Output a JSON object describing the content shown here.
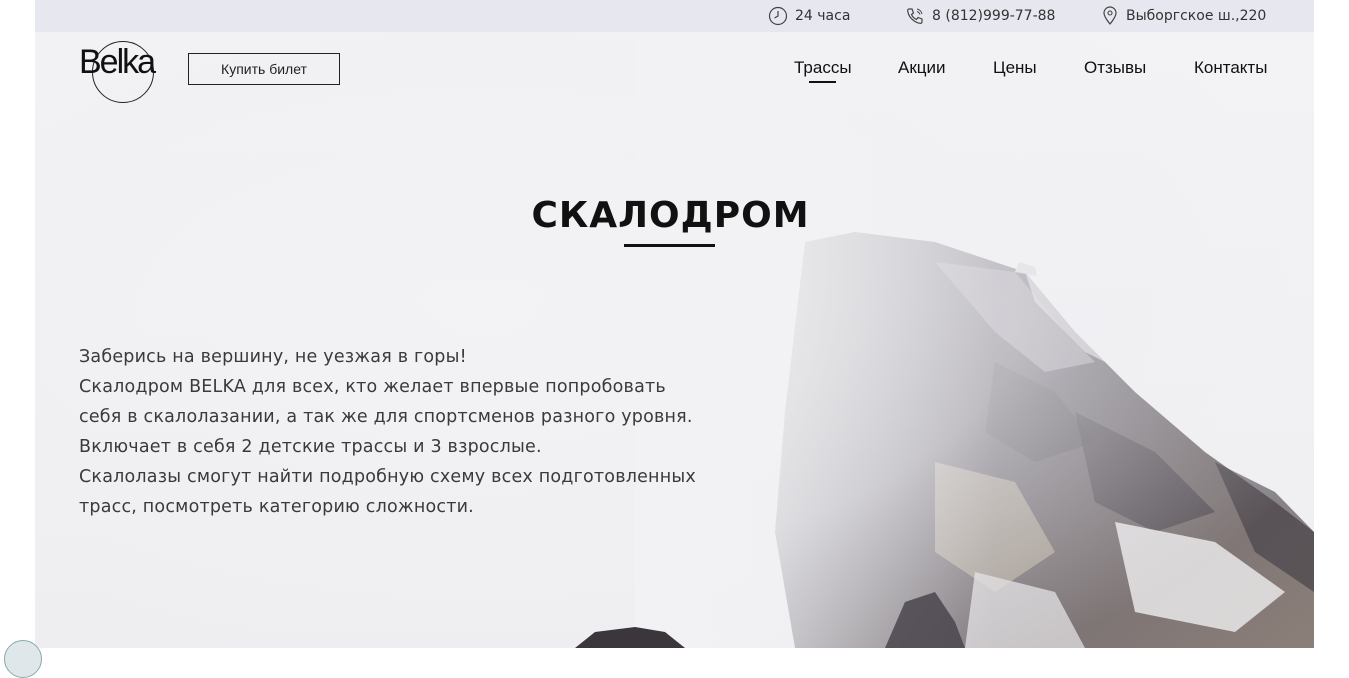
{
  "topbar": {
    "hours": "24 часа",
    "phone": "8 (812)999-77-88",
    "address": "Выборгское ш.,220",
    "icons": [
      "clock-icon",
      "phone-icon",
      "location-pin-icon"
    ]
  },
  "header": {
    "logo_text": "Belka",
    "buy_ticket_label": "Купить билет",
    "nav": [
      {
        "label": "Трассы",
        "active": true
      },
      {
        "label": "Акции",
        "active": false
      },
      {
        "label": "Цены",
        "active": false
      },
      {
        "label": "Отзывы",
        "active": false
      },
      {
        "label": "Контакты",
        "active": false
      }
    ]
  },
  "hero": {
    "title": "СКАЛОДРОМ",
    "description": [
      "Заберись на вершину, не уезжая в горы!",
      "Скалодром BELKA для всех, кто желает впервые попробовать",
      "себя в скалолазании, а так же для спортсменов разного уровня.",
      "Включает в себя 2 детские трассы и 3 взрослые.",
      "Скалолазы смогут найти подробную схему всех подготовленных",
      "трасс, посмотреть категорию сложности."
    ]
  },
  "colors": {
    "topbar_bg": "#e7e7ef",
    "text": "#111111",
    "body_text": "#3a3a3a"
  }
}
